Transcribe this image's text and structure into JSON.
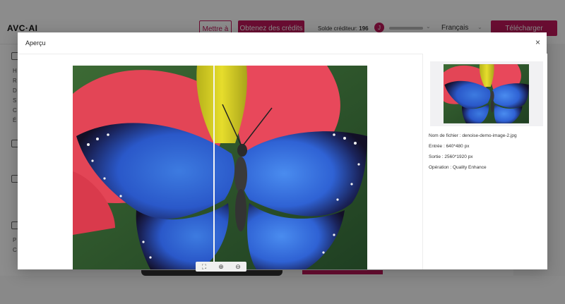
{
  "header": {
    "logo": "AVC·AI",
    "pin_button": "Mettre à",
    "credits_button": "Obtenez des crédits",
    "balance_label": "Solde créditeur:",
    "balance_value": "196",
    "avatar_initial": "J",
    "language": "Français",
    "upload_button": "Télécharger"
  },
  "sidebar": {
    "items": [
      "H",
      "R",
      "D",
      "S",
      "C",
      "É",
      "P",
      "C"
    ]
  },
  "modal": {
    "title": "Aperçu",
    "close_glyph": "×",
    "zoom": {
      "fit_icon": "fit-screen-icon",
      "zoom_in_icon": "zoom-in-icon",
      "zoom_out_icon": "zoom-out-icon",
      "fit_glyph": "⛶",
      "zoom_in_glyph": "⊕",
      "zoom_out_glyph": "⊖"
    },
    "info": {
      "filename": "Nom de fichier : denoise-demo-image-2.jpg",
      "input": "Entrée : 640*480 px",
      "output": "Sortie : 2560*1920 px",
      "operation": "Opération : Quality Enhance"
    }
  },
  "colors": {
    "brand": "#c2185b",
    "overlay": "rgba(0,0,0,0.45)"
  }
}
